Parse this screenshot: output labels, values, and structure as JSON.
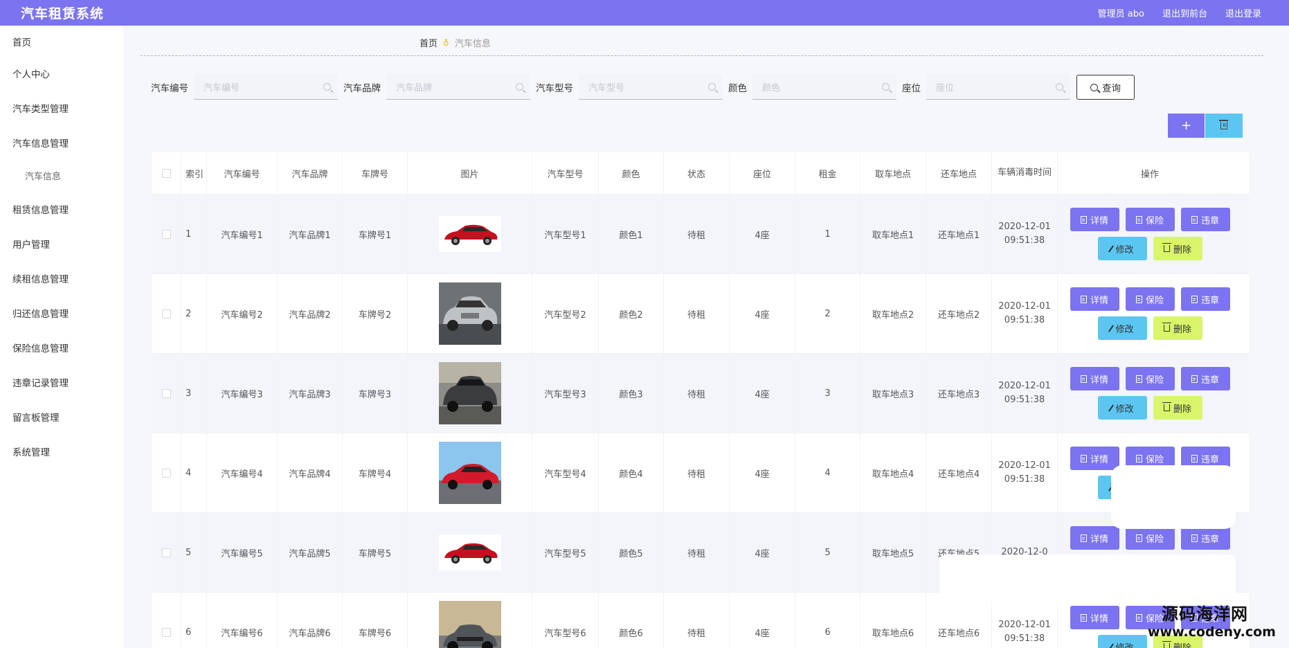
{
  "app": {
    "title": "汽车租赁系统",
    "admin_label": "管理员 abo",
    "to_front": "退出到前台",
    "logout": "退出登录"
  },
  "sidebar": {
    "items": [
      {
        "label": "首页"
      },
      {
        "label": "个人中心"
      },
      {
        "label": "汽车类型管理"
      },
      {
        "label": "汽车信息管理"
      },
      {
        "label": "汽车信息",
        "sub": true
      },
      {
        "label": "租赁信息管理"
      },
      {
        "label": "用户管理"
      },
      {
        "label": "续租信息管理"
      },
      {
        "label": "归还信息管理"
      },
      {
        "label": "保险信息管理"
      },
      {
        "label": "违章记录管理"
      },
      {
        "label": "留言板管理"
      },
      {
        "label": "系统管理"
      }
    ]
  },
  "breadcrumb": {
    "home": "首页",
    "current": "汽车信息"
  },
  "search": {
    "fields": [
      {
        "label": "汽车编号",
        "placeholder": "汽车编号"
      },
      {
        "label": "汽车品牌",
        "placeholder": "汽车品牌"
      },
      {
        "label": "汽车型号",
        "placeholder": "汽车型号"
      },
      {
        "label": "颜色",
        "placeholder": "颜色"
      },
      {
        "label": "座位",
        "placeholder": "座位"
      }
    ],
    "query_label": "查询"
  },
  "toolbar": {
    "add_symbol": "+"
  },
  "table": {
    "headers": [
      "索引",
      "汽车编号",
      "汽车品牌",
      "车牌号",
      "图片",
      "汽车型号",
      "颜色",
      "状态",
      "座位",
      "租金",
      "取车地点",
      "还车地点",
      "车辆消毒时间",
      "操作"
    ],
    "rows": [
      {
        "idx": "1",
        "no": "汽车编号1",
        "brand": "汽车品牌1",
        "plate": "车牌号1",
        "model": "汽车型号1",
        "color": "颜色1",
        "status": "待租",
        "seat": "4座",
        "rent": "1",
        "pick": "取车地点1",
        "ret": "还车地点1",
        "time": "2020-12-01 09:51:38",
        "img": "red-sedan"
      },
      {
        "idx": "2",
        "no": "汽车编号2",
        "brand": "汽车品牌2",
        "plate": "车牌号2",
        "model": "汽车型号2",
        "color": "颜色2",
        "status": "待租",
        "seat": "4座",
        "rent": "2",
        "pick": "取车地点2",
        "ret": "还车地点2",
        "time": "2020-12-01 09:51:38",
        "img": "silver-car"
      },
      {
        "idx": "3",
        "no": "汽车编号3",
        "brand": "汽车品牌3",
        "plate": "车牌号3",
        "model": "汽车型号3",
        "color": "颜色3",
        "status": "待租",
        "seat": "4座",
        "rent": "3",
        "pick": "取车地点3",
        "ret": "还车地点3",
        "time": "2020-12-01 09:51:38",
        "img": "dark-suv"
      },
      {
        "idx": "4",
        "no": "汽车编号4",
        "brand": "汽车品牌4",
        "plate": "车牌号4",
        "model": "汽车型号4",
        "color": "颜色4",
        "status": "待租",
        "seat": "4座",
        "rent": "4",
        "pick": "取车地点4",
        "ret": "还车地点4",
        "time": "2020-12-01 09:51:38",
        "img": "red-coupe"
      },
      {
        "idx": "5",
        "no": "汽车编号5",
        "brand": "汽车品牌5",
        "plate": "车牌号5",
        "model": "汽车型号5",
        "color": "颜色5",
        "status": "待租",
        "seat": "4座",
        "rent": "5",
        "pick": "取车地点5",
        "ret": "还车地点5",
        "time": "2020-12-0",
        "img": "red-sedan"
      },
      {
        "idx": "6",
        "no": "汽车编号6",
        "brand": "汽车品牌6",
        "plate": "车牌号6",
        "model": "汽车型号6",
        "color": "颜色6",
        "status": "待租",
        "seat": "4座",
        "rent": "6",
        "pick": "取车地点6",
        "ret": "还车地点6",
        "time": "2020-12-01 09:51:38",
        "img": "grey-muscle"
      }
    ],
    "ops": {
      "detail": "详情",
      "insurance": "保险",
      "violation": "违章",
      "edit": "修改",
      "delete": "删除"
    }
  },
  "watermark": {
    "line1": "源码海洋网",
    "line2": "www.codeny.com"
  },
  "colors": {
    "primary": "#7b73ef",
    "info": "#5bc6f2",
    "lime": "#d9f56a"
  }
}
